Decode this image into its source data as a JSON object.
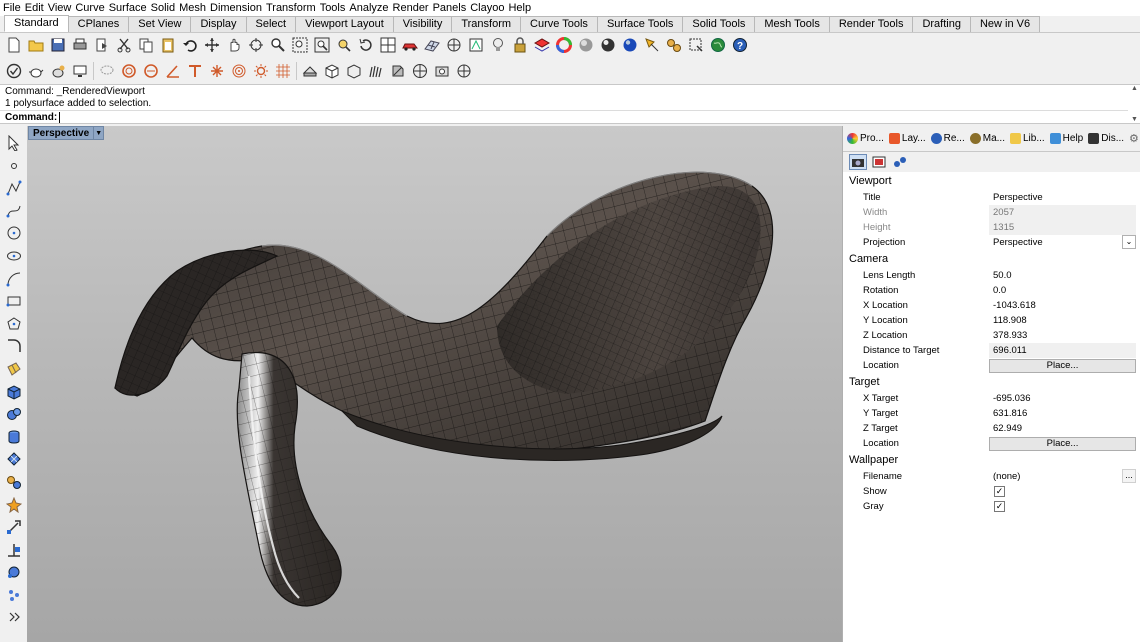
{
  "menubar": {
    "items": [
      "File",
      "Edit",
      "View",
      "Curve",
      "Surface",
      "Solid",
      "Mesh",
      "Dimension",
      "Transform",
      "Tools",
      "Analyze",
      "Render",
      "Panels",
      "Clayoo",
      "Help"
    ]
  },
  "tabs": {
    "items": [
      "Standard",
      "CPlanes",
      "Set View",
      "Display",
      "Select",
      "Viewport Layout",
      "Visibility",
      "Transform",
      "Curve Tools",
      "Surface Tools",
      "Solid Tools",
      "Mesh Tools",
      "Render Tools",
      "Drafting",
      "New in V6"
    ],
    "active": "Standard"
  },
  "command": {
    "line1": "Command: _RenderedViewport",
    "line2": "1 polysurface added to selection.",
    "prompt": "Command:"
  },
  "viewport": {
    "title": "Perspective",
    "dropdown_glyph": "▼"
  },
  "panel": {
    "tabs": [
      "Pro...",
      "Lay...",
      "Re...",
      "Ma...",
      "Lib...",
      "Help",
      "Dis..."
    ],
    "sections": {
      "viewport": "Viewport",
      "camera": "Camera",
      "target": "Target",
      "wallpaper": "Wallpaper"
    },
    "viewport_props": {
      "title_label": "Title",
      "title_value": "Perspective",
      "width_label": "Width",
      "width_value": "2057",
      "height_label": "Height",
      "height_value": "1315",
      "projection_label": "Projection",
      "projection_value": "Perspective"
    },
    "camera_props": {
      "lens_label": "Lens Length",
      "lens_value": "50.0",
      "rotation_label": "Rotation",
      "rotation_value": "0.0",
      "xloc_label": "X Location",
      "xloc_value": "-1043.618",
      "yloc_label": "Y Location",
      "yloc_value": "118.908",
      "zloc_label": "Z Location",
      "zloc_value": "378.933",
      "dist_label": "Distance to Target",
      "dist_value": "696.011",
      "location_label": "Location",
      "place_button": "Place..."
    },
    "target_props": {
      "xt_label": "X Target",
      "xt_value": "-695.036",
      "yt_label": "Y Target",
      "yt_value": "631.816",
      "zt_label": "Z Target",
      "zt_value": "62.949",
      "location_label": "Location",
      "place_button": "Place..."
    },
    "wallpaper_props": {
      "filename_label": "Filename",
      "filename_value": "(none)",
      "show_label": "Show",
      "show_checked": true,
      "gray_label": "Gray",
      "gray_checked": true
    }
  },
  "colors": {
    "viewport_title_bg": "#8fa6c4",
    "model_surface": "#4a423d",
    "model_edge": "#d8d8d8"
  }
}
